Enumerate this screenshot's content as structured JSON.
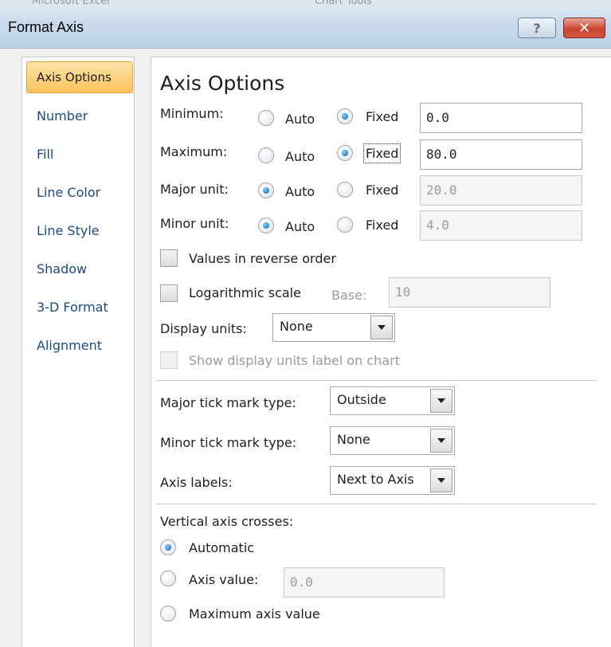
{
  "window": {
    "title": "Format Axis",
    "help": "?",
    "close": "✕"
  },
  "background": {
    "left_text": "Microsoft Excel",
    "right_text": "Chart Tools"
  },
  "nav": [
    "Axis Options",
    "Number",
    "Fill",
    "Line Color",
    "Line Style",
    "Shadow",
    "3-D Format",
    "Alignment"
  ],
  "section_title": "Axis Options",
  "scale": {
    "minimum": {
      "label": "Minimum:",
      "auto": "Auto",
      "fixed": "Fixed",
      "selected": "fixed",
      "value": "0.0"
    },
    "maximum": {
      "label": "Maximum:",
      "auto": "Auto",
      "fixed": "Fixed",
      "selected": "fixed",
      "value": "80.0"
    },
    "major_unit": {
      "label": "Major unit:",
      "auto": "Auto",
      "fixed": "Fixed",
      "selected": "auto",
      "value": "20.0"
    },
    "minor_unit": {
      "label": "Minor unit:",
      "auto": "Auto",
      "fixed": "Fixed",
      "selected": "auto",
      "value": "4.0"
    }
  },
  "reverse_order": {
    "label": "Values in reverse order",
    "checked": false
  },
  "log_scale": {
    "label": "Logarithmic scale",
    "checked": false,
    "base_label": "Base:",
    "base_value": "10"
  },
  "display_units": {
    "label": "Display units:",
    "value": "None"
  },
  "show_units_label": {
    "label": "Show display units label on chart",
    "checked": false
  },
  "ticks": {
    "major": {
      "label": "Major tick mark type:",
      "value": "Outside"
    },
    "minor": {
      "label": "Minor tick mark type:",
      "value": "None"
    },
    "axis_labels": {
      "label": "Axis labels:",
      "value": "Next to Axis"
    }
  },
  "crosses": {
    "heading": "Vertical axis crosses:",
    "automatic": "Automatic",
    "axis_value": "Axis value:",
    "axis_value_input": "0.0",
    "maximum": "Maximum axis value",
    "selected": "automatic"
  },
  "colors": {
    "accent": "#fbc25c",
    "nav_text": "#1a4a86",
    "radio_dot": "#0c5fb0"
  }
}
